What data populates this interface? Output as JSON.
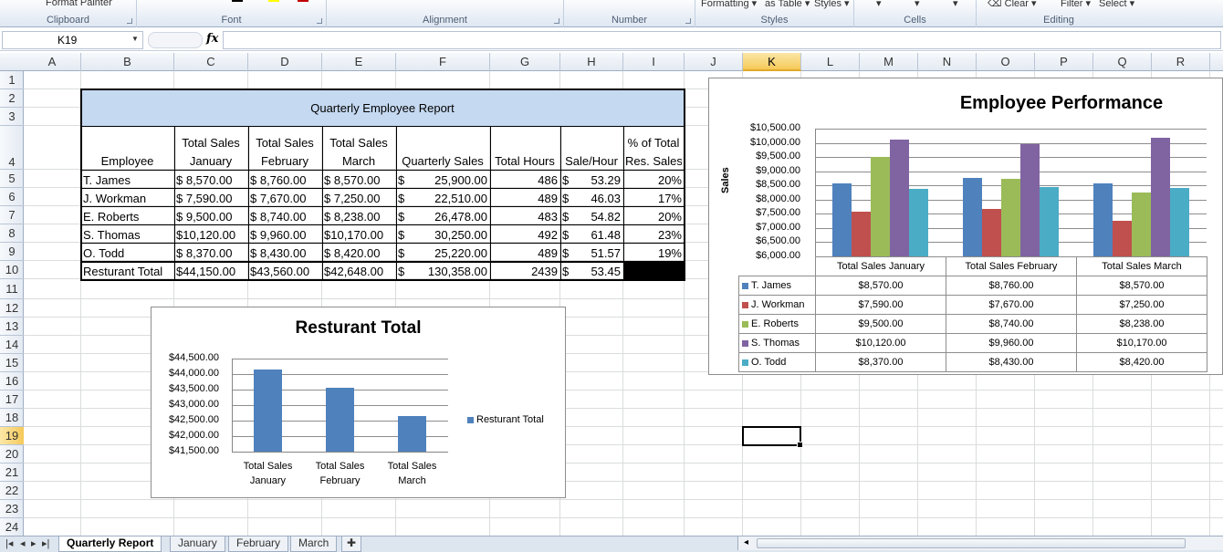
{
  "ribbon": {
    "partial_labels": [
      "Format Painter",
      "Formatting",
      "as Table",
      "Styles",
      "Clear",
      "Filter",
      "Select"
    ],
    "groups": [
      "Clipboard",
      "Font",
      "Alignment",
      "Number",
      "Styles",
      "Cells",
      "Editing"
    ]
  },
  "formula_bar": {
    "name_box": "K19",
    "fx_label": "fx",
    "content": ""
  },
  "columns": [
    "A",
    "B",
    "C",
    "D",
    "E",
    "F",
    "G",
    "H",
    "I",
    "J",
    "K",
    "L",
    "M",
    "N",
    "O",
    "P",
    "Q",
    "R"
  ],
  "rows": [
    "1",
    "2",
    "3",
    "4",
    "5",
    "6",
    "7",
    "8",
    "9",
    "10",
    "11",
    "12",
    "13",
    "14",
    "15",
    "16",
    "17",
    "18",
    "19",
    "20",
    "21",
    "22",
    "23",
    "24"
  ],
  "active_cell": {
    "column": "K",
    "row": "19"
  },
  "report": {
    "title": "Quarterly Employee Report",
    "headers": {
      "employee": "Employee",
      "jan": [
        "Total Sales",
        "January"
      ],
      "feb": [
        "Total Sales",
        "February"
      ],
      "mar": [
        "Total Sales",
        "March"
      ],
      "quarterly": "Quarterly Sales",
      "hours": "Total Hours",
      "sale_hour": "Sale/Hour",
      "pct": [
        "% of Total",
        "Res. Sales"
      ]
    },
    "rows": [
      {
        "name": "T. James",
        "jan": "$ 8,570.00",
        "feb": "$ 8,760.00",
        "mar": "$ 8,570.00",
        "q_sym": "$",
        "q_val": "25,900.00",
        "hours": "486",
        "sh_sym": "$",
        "sh_val": "53.29",
        "pct": "20%"
      },
      {
        "name": "J. Workman",
        "jan": "$ 7,590.00",
        "feb": "$ 7,670.00",
        "mar": "$ 7,250.00",
        "q_sym": "$",
        "q_val": "22,510.00",
        "hours": "489",
        "sh_sym": "$",
        "sh_val": "46.03",
        "pct": "17%"
      },
      {
        "name": "E. Roberts",
        "jan": "$ 9,500.00",
        "feb": "$ 8,740.00",
        "mar": "$ 8,238.00",
        "q_sym": "$",
        "q_val": "26,478.00",
        "hours": "483",
        "sh_sym": "$",
        "sh_val": "54.82",
        "pct": "20%"
      },
      {
        "name": "S. Thomas",
        "jan": "$10,120.00",
        "feb": "$ 9,960.00",
        "mar": "$10,170.00",
        "q_sym": "$",
        "q_val": "30,250.00",
        "hours": "492",
        "sh_sym": "$",
        "sh_val": "61.48",
        "pct": "23%"
      },
      {
        "name": "O. Todd",
        "jan": "$ 8,370.00",
        "feb": "$ 8,430.00",
        "mar": "$ 8,420.00",
        "q_sym": "$",
        "q_val": "25,220.00",
        "hours": "489",
        "sh_sym": "$",
        "sh_val": "51.57",
        "pct": "19%"
      }
    ],
    "total_row": {
      "name": "Resturant Total",
      "jan": "$44,150.00",
      "feb": "$43,560.00",
      "mar": "$42,648.00",
      "q_sym": "$",
      "q_val": "130,358.00",
      "hours": "2439",
      "sh_sym": "$",
      "sh_val": "53.45",
      "pct": ""
    }
  },
  "chart_data": [
    {
      "type": "bar",
      "title": "Resturant Total",
      "categories": [
        "Total Sales January",
        "Total Sales February",
        "Total Sales March"
      ],
      "category_lines": [
        [
          "Total Sales",
          "January"
        ],
        [
          "Total Sales",
          "February"
        ],
        [
          "Total Sales",
          "March"
        ]
      ],
      "series": [
        {
          "name": "Resturant Total",
          "values": [
            44150,
            43560,
            42648
          ],
          "color": "#4f81bd"
        }
      ],
      "ylim": [
        41500,
        44500
      ],
      "yticks": [
        "$44,500.00",
        "$44,000.00",
        "$43,500.00",
        "$43,000.00",
        "$42,500.00",
        "$42,000.00",
        "$41,500.00"
      ],
      "legend": "right",
      "grid": true
    },
    {
      "type": "bar",
      "title": "Employee Performance",
      "ylabel": "Sales",
      "categories": [
        "Total Sales January",
        "Total Sales February",
        "Total Sales March"
      ],
      "series": [
        {
          "name": "T. James",
          "values": [
            8570,
            8760,
            8570
          ],
          "color": "#4f81bd"
        },
        {
          "name": "J. Workman",
          "values": [
            7590,
            7670,
            7250
          ],
          "color": "#c0504d"
        },
        {
          "name": "E. Roberts",
          "values": [
            9500,
            8740,
            8238
          ],
          "color": "#9bbb59"
        },
        {
          "name": "S. Thomas",
          "values": [
            10120,
            9960,
            10170
          ],
          "color": "#8064a2"
        },
        {
          "name": "O. Todd",
          "values": [
            8370,
            8430,
            8420
          ],
          "color": "#4bacc6"
        }
      ],
      "ylim": [
        6000,
        10500
      ],
      "yticks": [
        "$10,500.00",
        "$10,000.00",
        "$9,500.00",
        "$9,000.00",
        "$8,500.00",
        "$8,000.00",
        "$7,500.00",
        "$7,000.00",
        "$6,500.00",
        "$6,000.00"
      ],
      "table_values": [
        [
          "$8,570.00",
          "$8,760.00",
          "$8,570.00"
        ],
        [
          "$7,590.00",
          "$7,670.00",
          "$7,250.00"
        ],
        [
          "$9,500.00",
          "$8,740.00",
          "$8,238.00"
        ],
        [
          "$10,120.00",
          "$9,960.00",
          "$10,170.00"
        ],
        [
          "$8,370.00",
          "$8,430.00",
          "$8,420.00"
        ]
      ],
      "legend": "data-table",
      "grid": true
    }
  ],
  "sheet_tabs": [
    "Quarterly Report",
    "January",
    "February",
    "March"
  ],
  "active_tab": "Quarterly Report",
  "colors": {
    "header_fill": "#c5d9f1",
    "ribbon_bg": "#dfe7f2",
    "selected_header": "#f5c958"
  }
}
